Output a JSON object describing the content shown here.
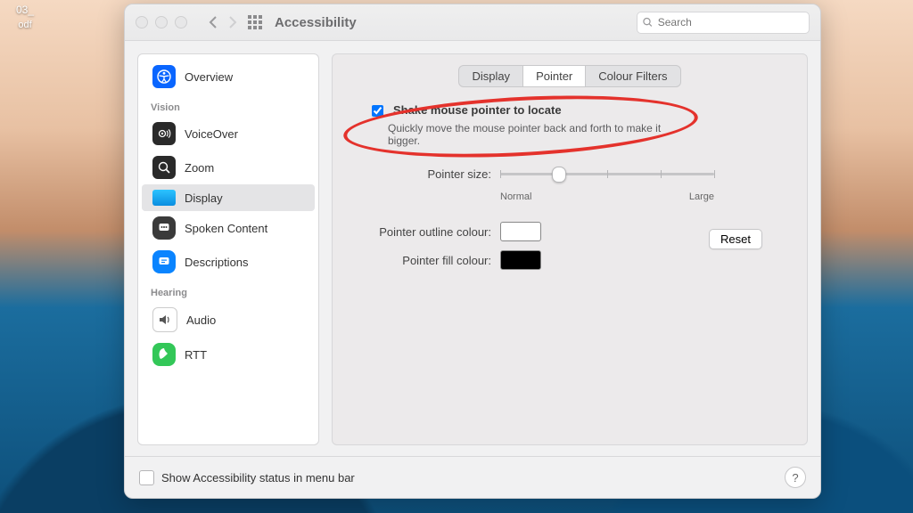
{
  "desktop": {
    "file_fragment_top": "03_",
    "file_fragment_bottom": "odf"
  },
  "window": {
    "title": "Accessibility",
    "search_placeholder": "Search"
  },
  "sidebar": {
    "overview": "Overview",
    "section_vision": "Vision",
    "voiceover": "VoiceOver",
    "zoom": "Zoom",
    "display": "Display",
    "spoken": "Spoken Content",
    "descriptions": "Descriptions",
    "section_hearing": "Hearing",
    "audio": "Audio",
    "rtt": "RTT"
  },
  "tabs": {
    "display": "Display",
    "pointer": "Pointer",
    "colour_filters": "Colour Filters"
  },
  "options": {
    "shake_label": "Shake mouse pointer to locate",
    "shake_desc": "Quickly move the mouse pointer back and forth to make it bigger.",
    "pointer_size": "Pointer size:",
    "size_min": "Normal",
    "size_max": "Large",
    "outline": "Pointer outline colour:",
    "fill": "Pointer fill colour:",
    "reset": "Reset"
  },
  "footer": {
    "menubar": "Show Accessibility status in menu bar",
    "help": "?"
  }
}
